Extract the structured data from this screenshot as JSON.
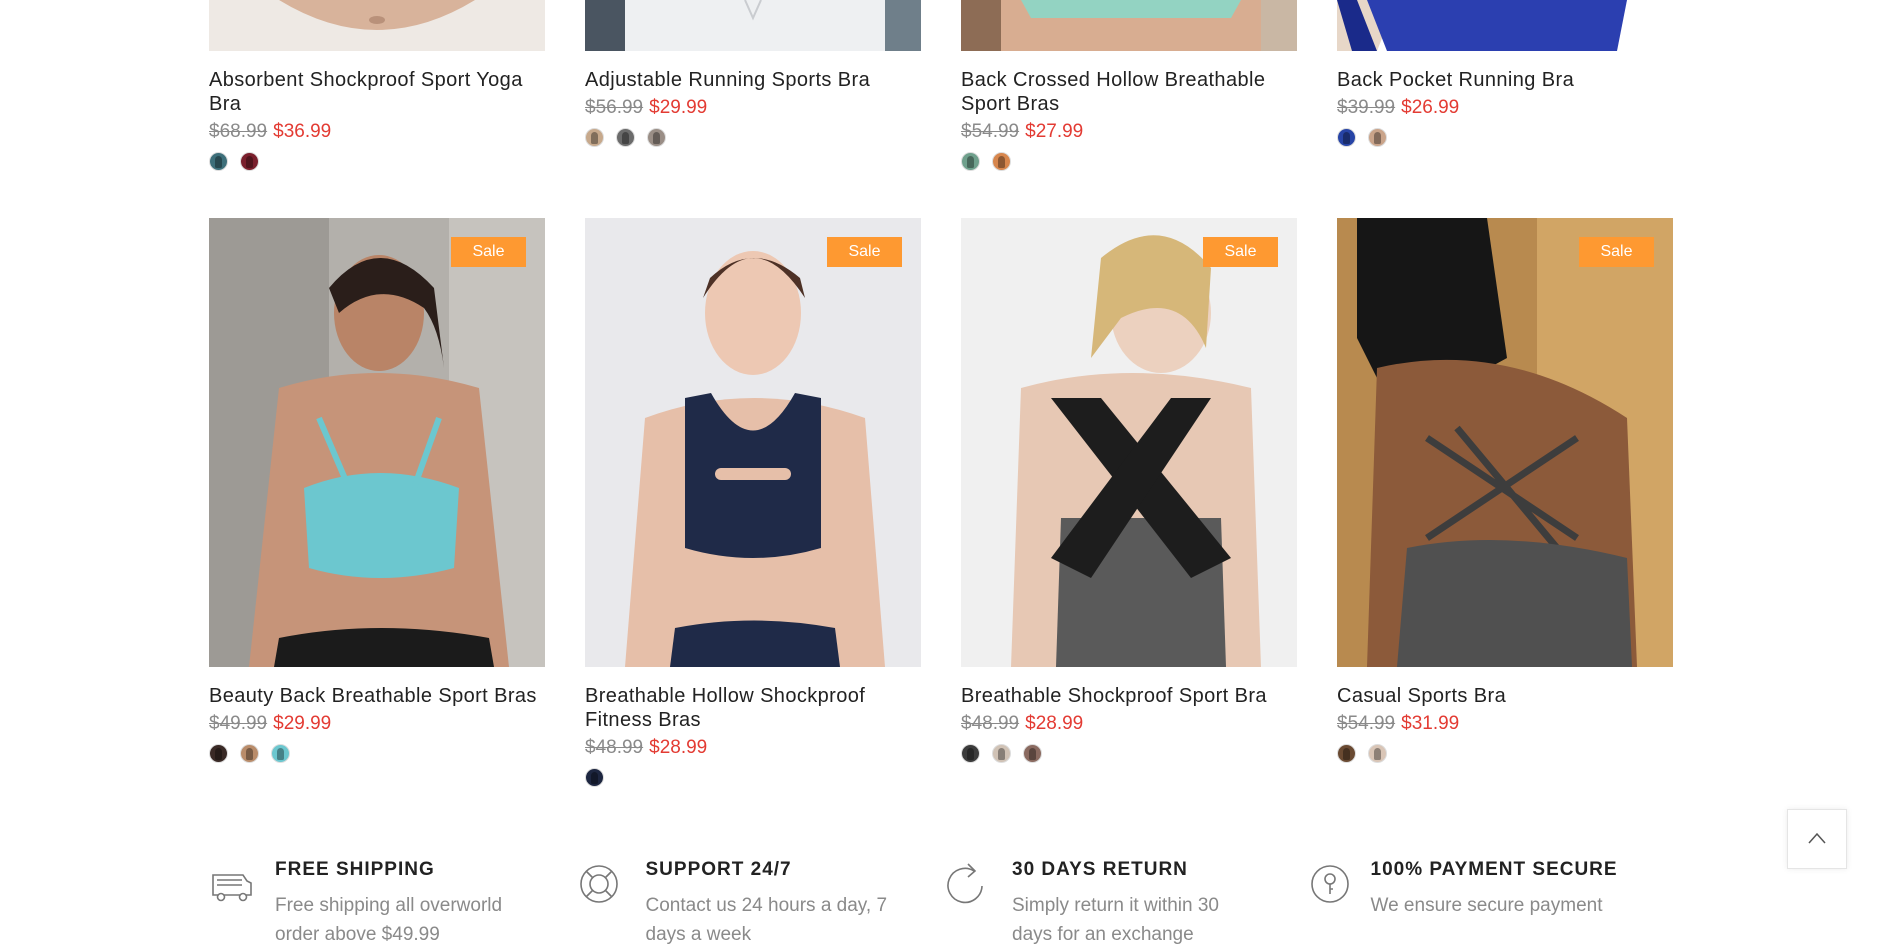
{
  "top_row": [
    {
      "title": "Absorbent Shockproof Sport Yoga Bra",
      "old_price": "$68.99",
      "new_price": "$36.99",
      "swatches": [
        "#3d6f7a",
        "#7a1f2c"
      ],
      "thumb_color": "#d8b39b"
    },
    {
      "title": "Adjustable Running Sports Bra",
      "old_price": "$56.99",
      "new_price": "$29.99",
      "swatches": [
        "#c7a98c",
        "#6b6b6b",
        "#9a8e86"
      ],
      "thumb_color": "#eef0f2"
    },
    {
      "title": "Back Crossed Hollow Breathable Sport Bras",
      "old_price": "$54.99",
      "new_price": "$27.99",
      "swatches": [
        "#6fa08c",
        "#d7864d"
      ],
      "thumb_color": "#93d3c2"
    },
    {
      "title": "Back Pocket Running Bra",
      "old_price": "$39.99",
      "new_price": "$26.99",
      "swatches": [
        "#2744a6",
        "#caa48a"
      ],
      "thumb_color": "#2b3fb0"
    }
  ],
  "bottom_row": [
    {
      "badge": "Sale",
      "title": "Beauty Back Breathable Sport Bras",
      "old_price": "$49.99",
      "new_price": "$29.99",
      "swatches": [
        "#3a2a26",
        "#b98c6a",
        "#6cc7cf"
      ]
    },
    {
      "badge": "Sale",
      "title": "Breathable Hollow Shockproof Fitness Bras",
      "old_price": "$48.99",
      "new_price": "$28.99",
      "swatches": [
        "#1d2640"
      ]
    },
    {
      "badge": "Sale",
      "title": "Breathable Shockproof Sport Bra",
      "old_price": "$48.99",
      "new_price": "$28.99",
      "swatches": [
        "#3b3b3b",
        "#d0c2b5",
        "#8a6a60"
      ]
    },
    {
      "badge": "Sale",
      "title": "Casual Sports Bra",
      "old_price": "$54.99",
      "new_price": "$31.99",
      "swatches": [
        "#6a4a32",
        "#d9c5b6"
      ]
    }
  ],
  "features": [
    {
      "title": "FREE SHIPPING",
      "desc": "Free shipping all overworld order above $49.99",
      "icon": "truck-icon"
    },
    {
      "title": "SUPPORT 24/7",
      "desc": "Contact us 24 hours a day, 7 days a week",
      "icon": "lifebuoy-icon"
    },
    {
      "title": "30 DAYS RETURN",
      "desc": "Simply return it within 30 days for an exchange",
      "icon": "refresh-icon"
    },
    {
      "title": "100% PAYMENT SECURE",
      "desc": "We ensure secure payment",
      "icon": "lock-icon"
    }
  ],
  "colors": {
    "sale_badge": "#fe9931",
    "new_price": "#e33b33",
    "old_price": "#8a8a8a"
  }
}
